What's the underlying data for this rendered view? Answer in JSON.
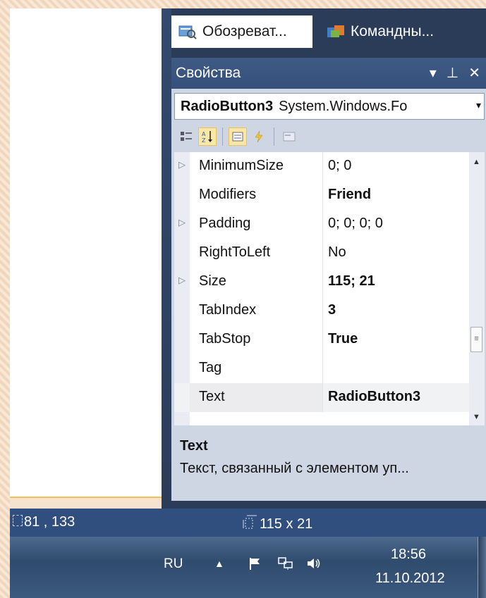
{
  "tabs": [
    {
      "label": "Обозреват...",
      "icon": "solution-explorer-icon"
    },
    {
      "label": "Командны...",
      "icon": "team-explorer-icon"
    }
  ],
  "panel": {
    "title": "Свойства",
    "object_name": "RadioButton3",
    "object_type": "System.Windows.Fo"
  },
  "properties": [
    {
      "name": "MinimumSize",
      "value": "0; 0",
      "expandable": true,
      "bold": false
    },
    {
      "name": "Modifiers",
      "value": "Friend",
      "expandable": false,
      "bold": true
    },
    {
      "name": "Padding",
      "value": "0; 0; 0; 0",
      "expandable": true,
      "bold": false
    },
    {
      "name": "RightToLeft",
      "value": "No",
      "expandable": false,
      "bold": false
    },
    {
      "name": "Size",
      "value": "115; 21",
      "expandable": true,
      "bold": true
    },
    {
      "name": "TabIndex",
      "value": "3",
      "expandable": false,
      "bold": true
    },
    {
      "name": "TabStop",
      "value": "True",
      "expandable": false,
      "bold": true
    },
    {
      "name": "Tag",
      "value": "",
      "expandable": false,
      "bold": false
    },
    {
      "name": "Text",
      "value": "RadioButton3",
      "expandable": false,
      "bold": true
    }
  ],
  "description": {
    "title": "Text",
    "text": "Текст, связанный с элементом уп..."
  },
  "status": {
    "position": "81 , 133",
    "size": "115 x 21"
  },
  "taskbar": {
    "language": "RU",
    "time": "18:56",
    "date": "11.10.2012"
  },
  "colors": {
    "ide_frame": "#2b3c59",
    "statusbar": "#304f7e",
    "panel": "#ced6e4",
    "toggle_active": "#fbe7a5"
  }
}
